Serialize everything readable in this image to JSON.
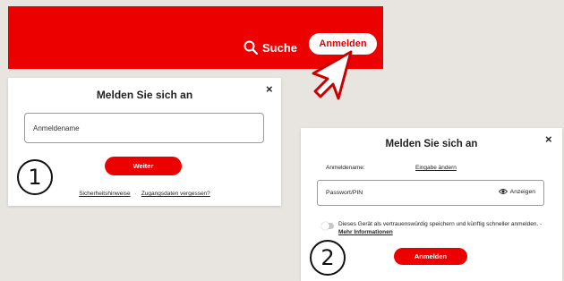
{
  "header": {
    "search_label": "Suche",
    "login_label": "Anmelden"
  },
  "step1": {
    "number": "1",
    "title": "Melden Sie sich an",
    "close": "×",
    "username_placeholder": "Anmeldename",
    "continue_label": "Weiter",
    "security_link": "Sicherheitshinweise",
    "separator": "·",
    "forgot_link": "Zugangsdaten vergessen?"
  },
  "step2": {
    "number": "2",
    "title": "Melden Sie sich an",
    "close": "×",
    "username_label": "Anmeldename:",
    "change_link": "Eingabe ändern",
    "password_placeholder": "Passwort/PIN",
    "show_label": "Anzeigen",
    "remember_text": "Dieses Gerät als vertrauenswürdig speichern und künftig schneller anmelden. -",
    "more_info_link": "Mehr Informationen",
    "login_label": "Anmelden"
  },
  "colors": {
    "brand_red": "#ec0000",
    "background": "#e8e5e1"
  }
}
